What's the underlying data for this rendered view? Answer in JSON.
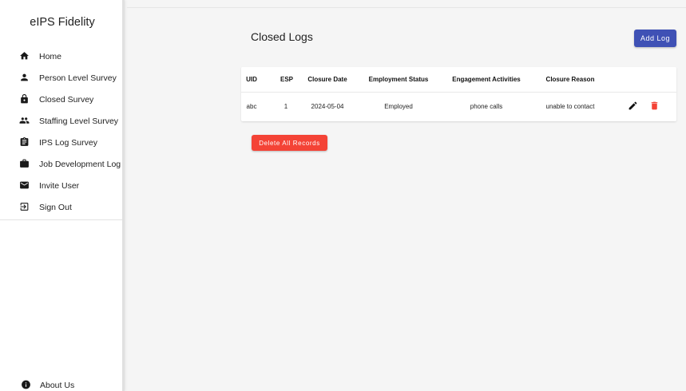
{
  "brand": "eIPS Fidelity",
  "sidebar": {
    "items": [
      {
        "label": "Home",
        "icon": "home-icon"
      },
      {
        "label": "Person Level Survey",
        "icon": "person-icon"
      },
      {
        "label": "Closed Survey",
        "icon": "lock-icon"
      },
      {
        "label": "Staffing Level Survey",
        "icon": "people-icon"
      },
      {
        "label": "IPS Log Survey",
        "icon": "clipboard-icon"
      },
      {
        "label": "Job Development Log",
        "icon": "briefcase-icon"
      },
      {
        "label": "Invite User",
        "icon": "mail-icon"
      },
      {
        "label": "Sign Out",
        "icon": "sign-out-icon"
      }
    ],
    "about": {
      "label": "About Us",
      "icon": "info-icon"
    }
  },
  "main": {
    "title": "Closed Logs",
    "add_button": "Add Log",
    "delete_all_button": "Delete All Records",
    "table": {
      "columns": [
        "UID",
        "ESP",
        "Closure Date",
        "Employment Status",
        "Engagement Activities",
        "Closure Reason"
      ],
      "rows": [
        [
          "abc",
          "1",
          "2024-05-04",
          "Employed",
          "phone calls",
          "unable to contact"
        ]
      ]
    }
  },
  "colors": {
    "primary": "#3f51b5",
    "danger": "#f44336",
    "sidebar_bg": "#ffffff",
    "page_bg": "#f5f5f5"
  }
}
